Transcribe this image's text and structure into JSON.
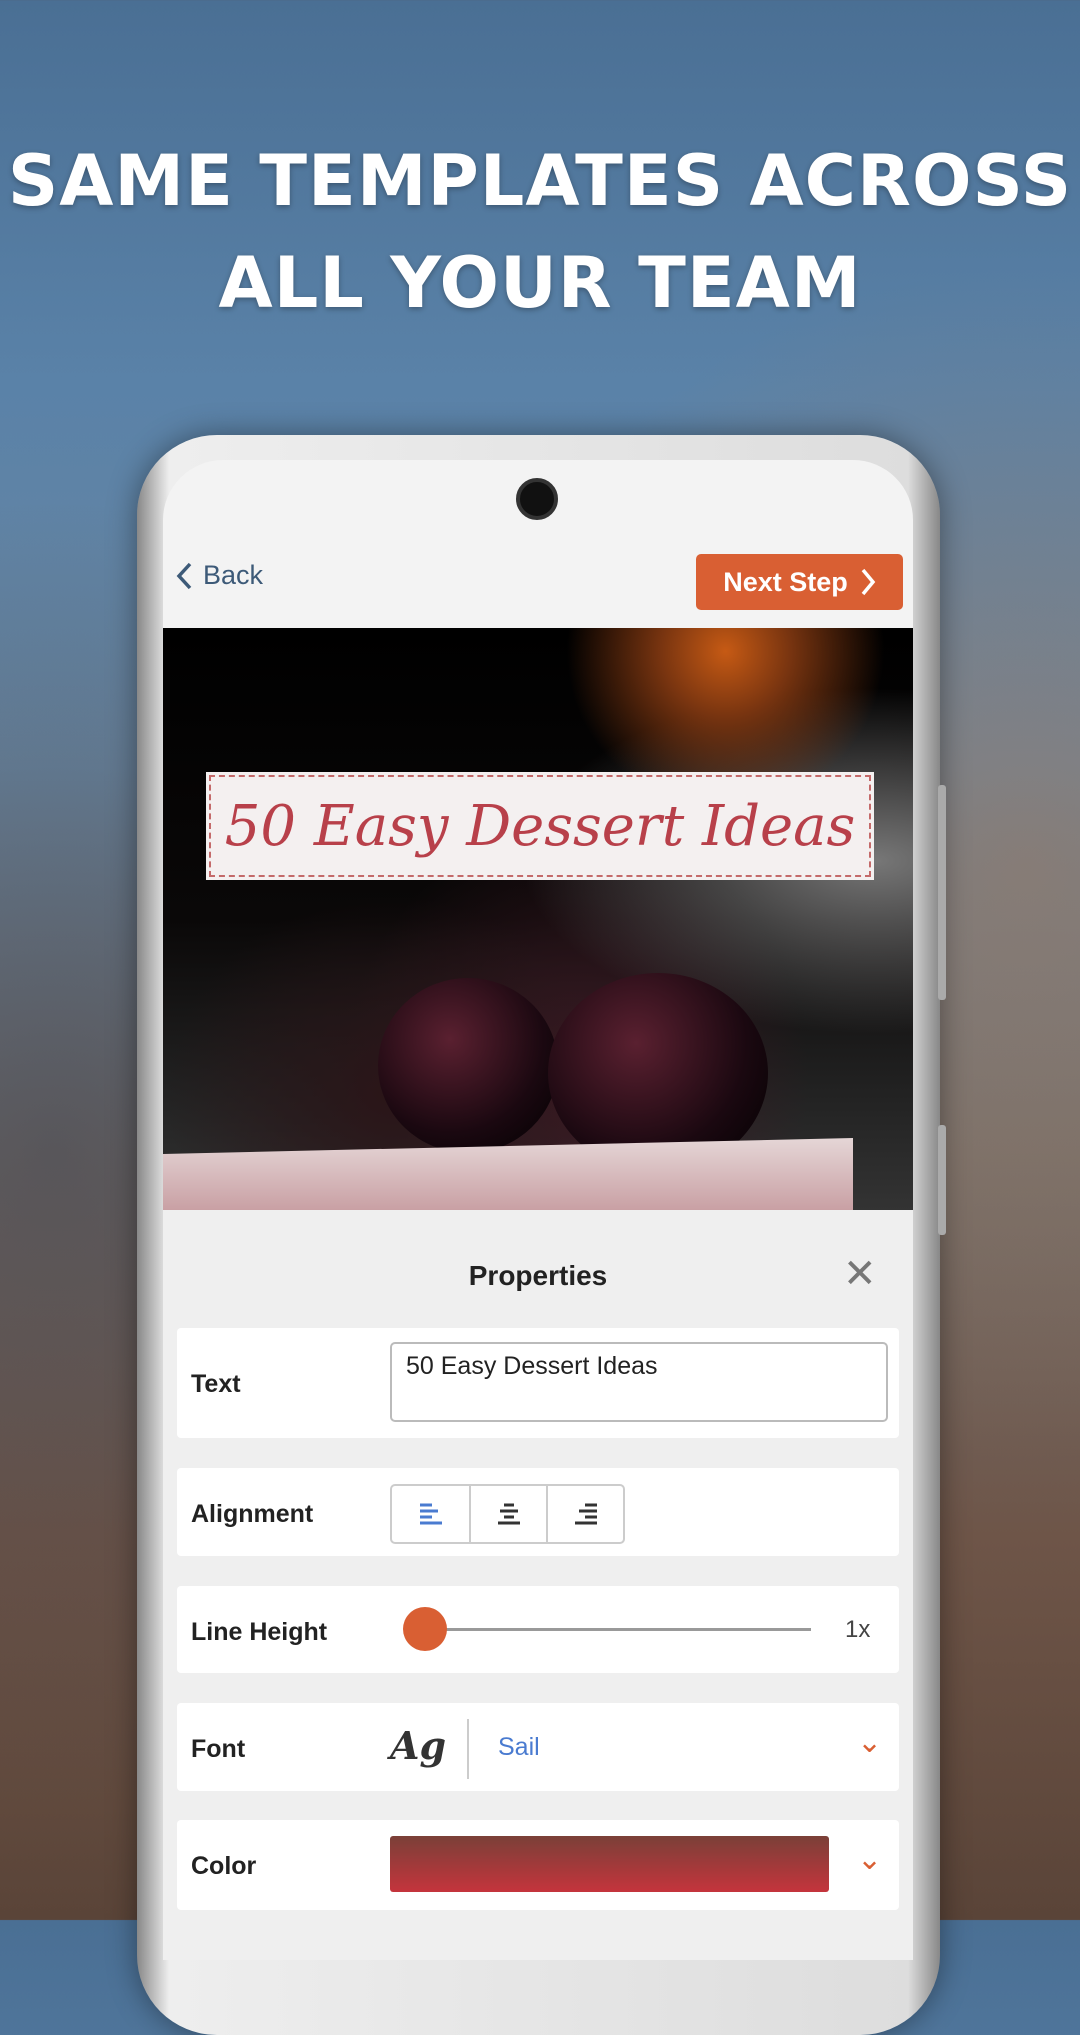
{
  "headline": {
    "line1": "SAME TEMPLATES ACROSS",
    "line2": "ALL YOUR TEAM"
  },
  "header": {
    "back_label": "Back",
    "next_label": "Next Step"
  },
  "canvas": {
    "title_text": "50 Easy Dessert Ideas"
  },
  "properties": {
    "title": "Properties",
    "text": {
      "label": "Text",
      "value": "50 Easy Dessert Ideas"
    },
    "alignment": {
      "label": "Alignment",
      "selected": "left"
    },
    "line_height": {
      "label": "Line Height",
      "value": "1x",
      "fraction": 0
    },
    "font": {
      "label": "Font",
      "preview": "Ag",
      "value": "Sail"
    },
    "color": {
      "label": "Color",
      "value_hex": "#b0363c"
    }
  },
  "colors": {
    "accent": "#d95f33",
    "link": "#4a7bd0"
  }
}
